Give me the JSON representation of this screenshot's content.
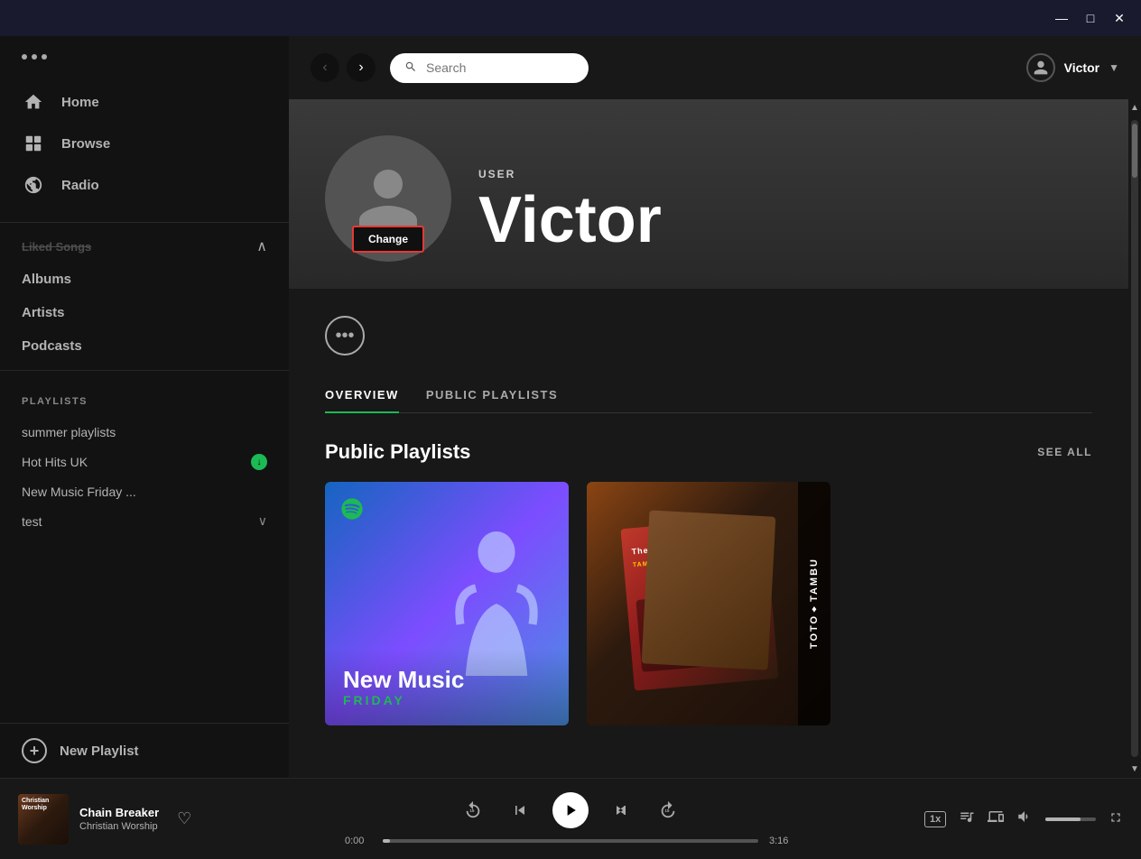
{
  "titleBar": {
    "minimize": "—",
    "maximize": "□",
    "close": "✕"
  },
  "sidebar": {
    "dotsMenu": "•••",
    "nav": [
      {
        "id": "home",
        "label": "Home",
        "icon": "home"
      },
      {
        "id": "browse",
        "label": "Browse",
        "icon": "browse"
      },
      {
        "id": "radio",
        "label": "Radio",
        "icon": "radio"
      }
    ],
    "librarySection": {
      "likedSongs": "Liked Songs",
      "albums": "Albums",
      "artists": "Artists",
      "podcasts": "Podcasts"
    },
    "playlistsLabel": "PLAYLISTS",
    "playlists": [
      {
        "id": "summer",
        "label": "summer playlists",
        "badge": null,
        "chevron": false
      },
      {
        "id": "hothits",
        "label": "Hot Hits UK",
        "badge": "download",
        "chevron": false
      },
      {
        "id": "newmusic",
        "label": "New Music Friday ...",
        "badge": null,
        "chevron": false
      },
      {
        "id": "test",
        "label": "test",
        "badge": null,
        "chevron": true
      }
    ],
    "newPlaylist": "New Playlist"
  },
  "topBar": {
    "searchPlaceholder": "Search",
    "user": "Victor",
    "chevron": "▼"
  },
  "profile": {
    "typeLabel": "USER",
    "name": "Victor",
    "changeBtn": "Change",
    "moreBtn": "•••",
    "tabs": [
      {
        "id": "overview",
        "label": "OVERVIEW",
        "active": true
      },
      {
        "id": "public",
        "label": "PUBLIC PLAYLISTS",
        "active": false
      }
    ],
    "publicPlaylists": {
      "title": "Public Playlists",
      "seeAll": "SEE ALL",
      "cards": [
        {
          "id": "newmusicfriday",
          "title": "New Music",
          "subtitle": "FRIDAY",
          "type": "blue"
        },
        {
          "id": "tambu",
          "title": "TOTO♦TAMBU",
          "type": "tambu"
        }
      ]
    }
  },
  "player": {
    "albumArt": "Christian Worship",
    "trackName": "Chain Breaker",
    "artistName": "Christian Worship",
    "skipBack": "⏮",
    "rewind": "⏪",
    "play": "▶",
    "fastForward": "⏩",
    "skipForward": "⏭",
    "currentTime": "0:00",
    "totalTime": "3:16",
    "speed": "1x",
    "heart": "♡"
  }
}
